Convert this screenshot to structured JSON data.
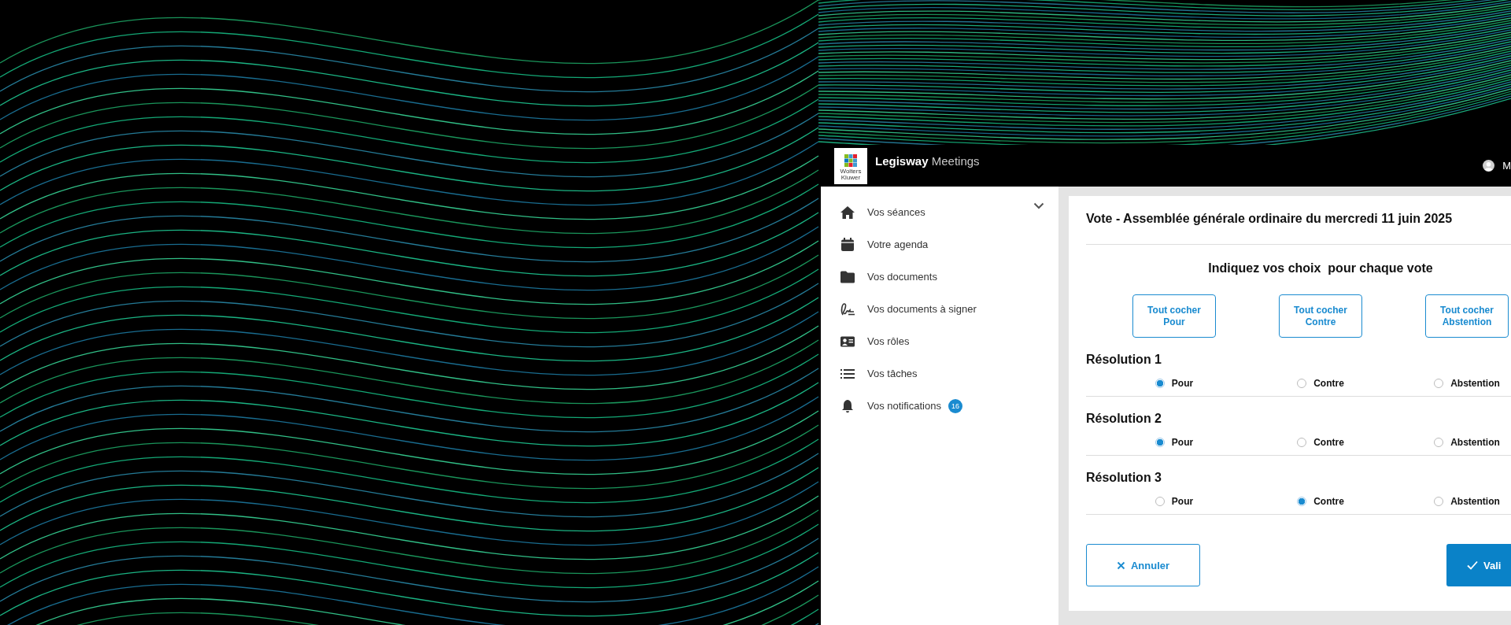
{
  "header": {
    "logo_text": "Wolters Kluwer",
    "app_name": "**Legisway** Meetings",
    "user": "M"
  },
  "sidebar": {
    "items": [
      {
        "label": "Vos séances"
      },
      {
        "label": "Votre agenda"
      },
      {
        "label": "Vos documents"
      },
      {
        "label": "Vos documents à signer"
      },
      {
        "label": "Vos rôles"
      },
      {
        "label": "Vos tâches"
      },
      {
        "label": "Vos notifications",
        "badge": "16"
      }
    ]
  },
  "vote": {
    "title": "Vote - Assemblée générale ordinaire du mercredi 11 juin 2025",
    "instruction": "Indiquez vos choix  pour chaque vote",
    "bulk_buttons": [
      "Tout cocher Pour",
      "Tout cocher Contre",
      "Tout cocher Abstention"
    ],
    "resolutions": [
      {
        "title": "Résolution 1",
        "options": [
          {
            "label": "Pour",
            "selected": true
          },
          {
            "label": "Contre",
            "selected": false
          },
          {
            "label": "Abstention",
            "selected": false
          }
        ]
      },
      {
        "title": "Résolution 2",
        "options": [
          {
            "label": "Pour",
            "selected": true
          },
          {
            "label": "Contre",
            "selected": false
          },
          {
            "label": "Abstention",
            "selected": false
          }
        ]
      },
      {
        "title": "Résolution 3",
        "options": [
          {
            "label": "Pour",
            "selected": false
          },
          {
            "label": "Contre",
            "selected": true
          },
          {
            "label": "Abstention",
            "selected": false
          }
        ]
      }
    ],
    "actions": [
      {
        "kind": "cancel",
        "label": "Annuler"
      },
      {
        "kind": "confirm",
        "label": "Vali"
      }
    ]
  }
}
